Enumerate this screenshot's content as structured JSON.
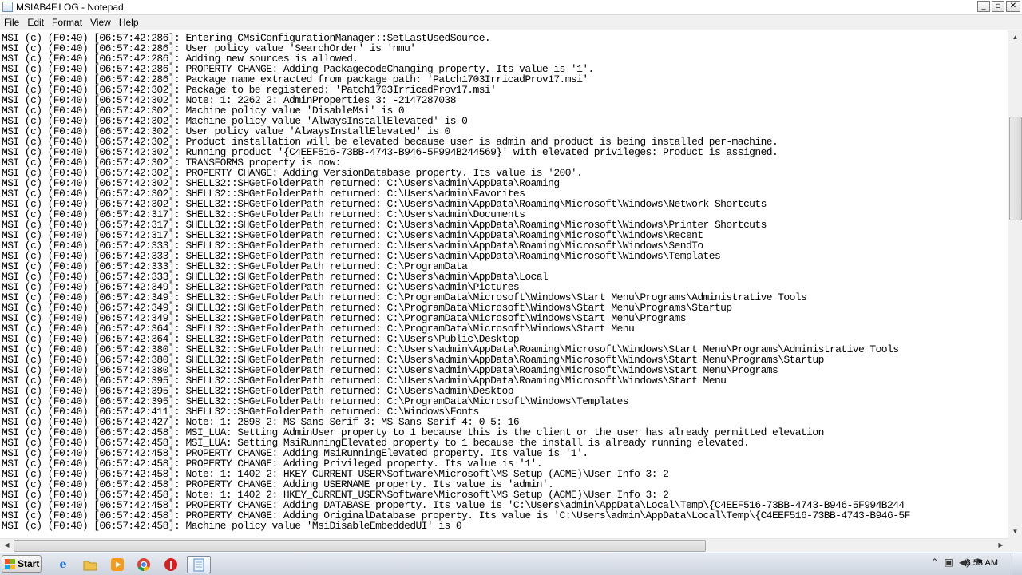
{
  "window": {
    "title": "MSIAB4F.LOG - Notepad",
    "controls": {
      "minimize": "_",
      "maximize": "▫",
      "close": "✕"
    }
  },
  "menu": [
    "File",
    "Edit",
    "Format",
    "View",
    "Help"
  ],
  "log_lines": [
    "MSI (c) (F0:40) [06:57:42:286]: Entering CMsiConfigurationManager::SetLastUsedSource.",
    "MSI (c) (F0:40) [06:57:42:286]: User policy value 'SearchOrder' is 'nmu'",
    "MSI (c) (F0:40) [06:57:42:286]: Adding new sources is allowed.",
    "MSI (c) (F0:40) [06:57:42:286]: PROPERTY CHANGE: Adding PackagecodeChanging property. Its value is '1'.",
    "MSI (c) (F0:40) [06:57:42:286]: Package name extracted from package path: 'Patch1703IrricadProv17.msi'",
    "MSI (c) (F0:40) [06:57:42:302]: Package to be registered: 'Patch1703IrricadProv17.msi'",
    "MSI (c) (F0:40) [06:57:42:302]: Note: 1: 2262 2: AdminProperties 3: -2147287038",
    "MSI (c) (F0:40) [06:57:42:302]: Machine policy value 'DisableMsi' is 0",
    "MSI (c) (F0:40) [06:57:42:302]: Machine policy value 'AlwaysInstallElevated' is 0",
    "MSI (c) (F0:40) [06:57:42:302]: User policy value 'AlwaysInstallElevated' is 0",
    "MSI (c) (F0:40) [06:57:42:302]: Product installation will be elevated because user is admin and product is being installed per-machine.",
    "MSI (c) (F0:40) [06:57:42:302]: Running product '{C4EEF516-73BB-4743-B946-5F994B244569}' with elevated privileges: Product is assigned.",
    "MSI (c) (F0:40) [06:57:42:302]: TRANSFORMS property is now:",
    "MSI (c) (F0:40) [06:57:42:302]: PROPERTY CHANGE: Adding VersionDatabase property. Its value is '200'.",
    "MSI (c) (F0:40) [06:57:42:302]: SHELL32::SHGetFolderPath returned: C:\\Users\\admin\\AppData\\Roaming",
    "MSI (c) (F0:40) [06:57:42:302]: SHELL32::SHGetFolderPath returned: C:\\Users\\admin\\Favorites",
    "MSI (c) (F0:40) [06:57:42:302]: SHELL32::SHGetFolderPath returned: C:\\Users\\admin\\AppData\\Roaming\\Microsoft\\Windows\\Network Shortcuts",
    "MSI (c) (F0:40) [06:57:42:317]: SHELL32::SHGetFolderPath returned: C:\\Users\\admin\\Documents",
    "MSI (c) (F0:40) [06:57:42:317]: SHELL32::SHGetFolderPath returned: C:\\Users\\admin\\AppData\\Roaming\\Microsoft\\Windows\\Printer Shortcuts",
    "MSI (c) (F0:40) [06:57:42:317]: SHELL32::SHGetFolderPath returned: C:\\Users\\admin\\AppData\\Roaming\\Microsoft\\Windows\\Recent",
    "MSI (c) (F0:40) [06:57:42:333]: SHELL32::SHGetFolderPath returned: C:\\Users\\admin\\AppData\\Roaming\\Microsoft\\Windows\\SendTo",
    "MSI (c) (F0:40) [06:57:42:333]: SHELL32::SHGetFolderPath returned: C:\\Users\\admin\\AppData\\Roaming\\Microsoft\\Windows\\Templates",
    "MSI (c) (F0:40) [06:57:42:333]: SHELL32::SHGetFolderPath returned: C:\\ProgramData",
    "MSI (c) (F0:40) [06:57:42:333]: SHELL32::SHGetFolderPath returned: C:\\Users\\admin\\AppData\\Local",
    "MSI (c) (F0:40) [06:57:42:349]: SHELL32::SHGetFolderPath returned: C:\\Users\\admin\\Pictures",
    "MSI (c) (F0:40) [06:57:42:349]: SHELL32::SHGetFolderPath returned: C:\\ProgramData\\Microsoft\\Windows\\Start Menu\\Programs\\Administrative Tools",
    "MSI (c) (F0:40) [06:57:42:349]: SHELL32::SHGetFolderPath returned: C:\\ProgramData\\Microsoft\\Windows\\Start Menu\\Programs\\Startup",
    "MSI (c) (F0:40) [06:57:42:349]: SHELL32::SHGetFolderPath returned: C:\\ProgramData\\Microsoft\\Windows\\Start Menu\\Programs",
    "MSI (c) (F0:40) [06:57:42:364]: SHELL32::SHGetFolderPath returned: C:\\ProgramData\\Microsoft\\Windows\\Start Menu",
    "MSI (c) (F0:40) [06:57:42:364]: SHELL32::SHGetFolderPath returned: C:\\Users\\Public\\Desktop",
    "MSI (c) (F0:40) [06:57:42:380]: SHELL32::SHGetFolderPath returned: C:\\Users\\admin\\AppData\\Roaming\\Microsoft\\Windows\\Start Menu\\Programs\\Administrative Tools",
    "MSI (c) (F0:40) [06:57:42:380]: SHELL32::SHGetFolderPath returned: C:\\Users\\admin\\AppData\\Roaming\\Microsoft\\Windows\\Start Menu\\Programs\\Startup",
    "MSI (c) (F0:40) [06:57:42:380]: SHELL32::SHGetFolderPath returned: C:\\Users\\admin\\AppData\\Roaming\\Microsoft\\Windows\\Start Menu\\Programs",
    "MSI (c) (F0:40) [06:57:42:395]: SHELL32::SHGetFolderPath returned: C:\\Users\\admin\\AppData\\Roaming\\Microsoft\\Windows\\Start Menu",
    "MSI (c) (F0:40) [06:57:42:395]: SHELL32::SHGetFolderPath returned: C:\\Users\\admin\\Desktop",
    "MSI (c) (F0:40) [06:57:42:395]: SHELL32::SHGetFolderPath returned: C:\\ProgramData\\Microsoft\\Windows\\Templates",
    "MSI (c) (F0:40) [06:57:42:411]: SHELL32::SHGetFolderPath returned: C:\\Windows\\Fonts",
    "MSI (c) (F0:40) [06:57:42:427]: Note: 1: 2898 2: MS Sans Serif 3: MS Sans Serif 4: 0 5: 16",
    "MSI (c) (F0:40) [06:57:42:458]: MSI_LUA: Setting AdminUser property to 1 because this is the client or the user has already permitted elevation",
    "MSI (c) (F0:40) [06:57:42:458]: MSI_LUA: Setting MsiRunningElevated property to 1 because the install is already running elevated.",
    "MSI (c) (F0:40) [06:57:42:458]: PROPERTY CHANGE: Adding MsiRunningElevated property. Its value is '1'.",
    "MSI (c) (F0:40) [06:57:42:458]: PROPERTY CHANGE: Adding Privileged property. Its value is '1'.",
    "MSI (c) (F0:40) [06:57:42:458]: Note: 1: 1402 2: HKEY_CURRENT_USER\\Software\\Microsoft\\MS Setup (ACME)\\User Info 3: 2",
    "MSI (c) (F0:40) [06:57:42:458]: PROPERTY CHANGE: Adding USERNAME property. Its value is 'admin'.",
    "MSI (c) (F0:40) [06:57:42:458]: Note: 1: 1402 2: HKEY_CURRENT_USER\\Software\\Microsoft\\MS Setup (ACME)\\User Info 3: 2",
    "MSI (c) (F0:40) [06:57:42:458]: PROPERTY CHANGE: Adding DATABASE property. Its value is 'C:\\Users\\admin\\AppData\\Local\\Temp\\{C4EEF516-73BB-4743-B946-5F994B244",
    "MSI (c) (F0:40) [06:57:42:458]: PROPERTY CHANGE: Adding OriginalDatabase property. Its value is 'C:\\Users\\admin\\AppData\\Local\\Temp\\{C4EEF516-73BB-4743-B946-5F",
    "MSI (c) (F0:40) [06:57:42:458]: Machine policy value 'MsiDisableEmbeddedUI' is 0"
  ],
  "scroll": {
    "vertical_position": 0.17,
    "horizontal_position": 0.0
  },
  "taskbar": {
    "start_label": "Start",
    "icons": [
      "internet-explorer-icon",
      "folder-icon",
      "media-player-icon",
      "chrome-icon",
      "stop-icon",
      "notepad-icon"
    ],
    "clock": "6:58 AM"
  },
  "colors": {
    "menu_bg": "#f0f0f0",
    "taskbar_top": "#e6eaf0",
    "taskbar_bottom": "#cdd4de"
  }
}
